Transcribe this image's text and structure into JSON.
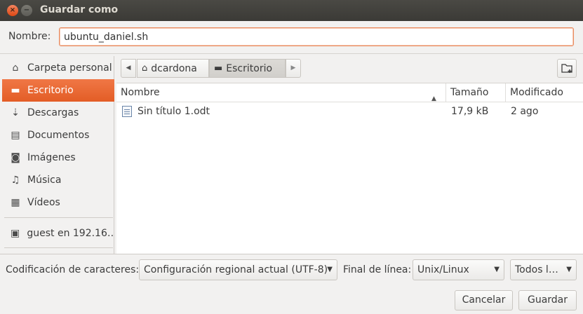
{
  "window": {
    "title": "Guardar como"
  },
  "name_row": {
    "label": "Nombre:",
    "value": "ubuntu_daniel.sh"
  },
  "sidebar": {
    "items": [
      {
        "label": "Carpeta personal",
        "icon": "home-icon"
      },
      {
        "label": "Escritorio",
        "icon": "folder-icon",
        "active": true
      },
      {
        "label": "Descargas",
        "icon": "download-icon"
      },
      {
        "label": "Documentos",
        "icon": "document-icon"
      },
      {
        "label": "Imágenes",
        "icon": "camera-icon"
      },
      {
        "label": "Música",
        "icon": "music-icon"
      },
      {
        "label": "Vídeos",
        "icon": "film-icon"
      },
      {
        "label": "guest en 192.16…",
        "icon": "network-icon"
      }
    ]
  },
  "pathbar": {
    "crumbs": [
      "dcardona",
      "Escritorio"
    ]
  },
  "filelist": {
    "columns": {
      "name": "Nombre",
      "size": "Tamaño",
      "modified": "Modificado"
    },
    "rows": [
      {
        "name": "Sin título 1.odt",
        "size": "17,9 kB",
        "modified": "2 ago"
      }
    ]
  },
  "options": {
    "encoding_label": "Codificación de caracteres:",
    "encoding_value": "Configuración regional actual (UTF-8)",
    "line_end_label": "Final de línea:",
    "line_end_value": "Unix/Linux",
    "filter_value": "Todos l…"
  },
  "buttons": {
    "cancel": "Cancelar",
    "save": "Guardar"
  },
  "colors": {
    "accent": "#e95420",
    "titlebar": "#3c3b37"
  }
}
